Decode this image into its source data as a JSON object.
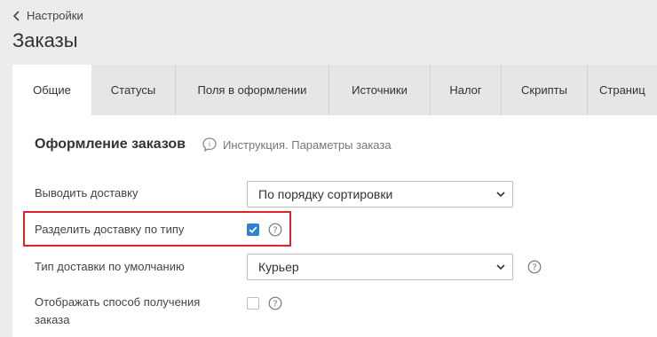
{
  "breadcrumb": {
    "label": "Настройки"
  },
  "page": {
    "title": "Заказы"
  },
  "tabs": [
    {
      "label": "Общие"
    },
    {
      "label": "Статусы"
    },
    {
      "label": "Поля в оформлении"
    },
    {
      "label": "Источники"
    },
    {
      "label": "Налог"
    },
    {
      "label": "Скрипты"
    },
    {
      "label": "Страниц"
    }
  ],
  "section": {
    "title": "Оформление заказов",
    "help_link": "Инструкция. Параметры заказа"
  },
  "fields": {
    "show_delivery": {
      "label": "Выводить доставку",
      "value": "По порядку сортировки"
    },
    "split_delivery": {
      "label": "Разделить доставку по типу",
      "checked": true
    },
    "default_delivery": {
      "label": "Тип доставки по умолчанию",
      "value": "Курьер"
    },
    "show_receive_method": {
      "label_line1": "Отображать способ получения",
      "label_line2": "заказа",
      "checked": false
    }
  },
  "colors": {
    "accent": "#2f7fd3",
    "highlight": "#d9252b",
    "background": "#ececec",
    "panel": "#ffffff"
  }
}
